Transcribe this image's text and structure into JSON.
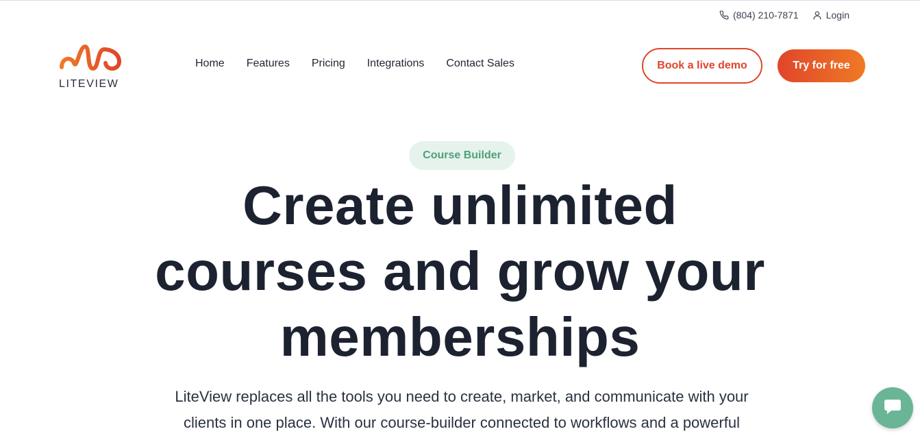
{
  "utility": {
    "phone": "(804) 210-7871",
    "login": "Login"
  },
  "brand": {
    "name": "LITEVIEW",
    "accent_start": "#e0452b",
    "accent_end": "#ef7a25"
  },
  "nav": {
    "items": [
      "Home",
      "Features",
      "Pricing",
      "Integrations",
      "Contact Sales"
    ]
  },
  "cta": {
    "demo": "Book a live demo",
    "try": "Try for free"
  },
  "hero": {
    "badge": "Course Builder",
    "headline_lines": [
      "Create unlimited",
      "courses and grow your",
      "memberships"
    ],
    "subcopy_lines": [
      "LiteView replaces all the tools you need to create, market, and communicate with your",
      "clients in one place. With our course-builder connected to workflows and a powerful"
    ]
  },
  "icons": {
    "phone": "phone-icon",
    "user": "user-icon",
    "chat": "chat-icon"
  },
  "colors": {
    "badge_bg": "#e6f3ec",
    "badge_text": "#4f9f7a",
    "chat_bg": "#6ab596",
    "heading": "#1c2230"
  }
}
